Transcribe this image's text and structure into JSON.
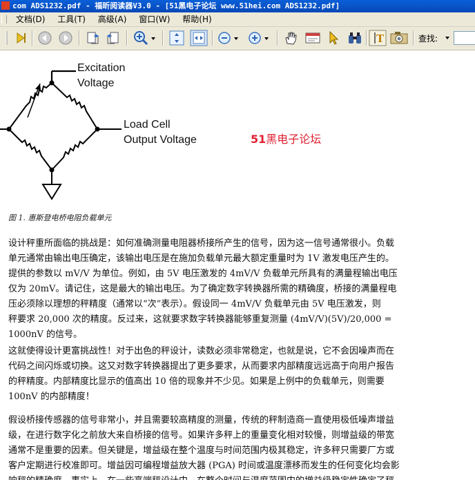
{
  "window": {
    "title": "com ADS1232.pdf - 福昕阅读器V3.0 - [51黑电子论坛 www.51hei.com ADS1232.pdf]"
  },
  "menu": {
    "items": [
      "文档(D)",
      "工具(T)",
      "高级(A)",
      "窗口(W)",
      "帮助(H)"
    ]
  },
  "toolbar": {
    "find_label": "查找:",
    "find_value": ""
  },
  "figure": {
    "label_excitation_1": "Excitation",
    "label_excitation_2": "Voltage",
    "label_output_1": "Load Cell",
    "label_output_2": "Output Voltage",
    "watermark_num": "51",
    "watermark_text": "黑电子论坛",
    "caption": "图 1. 惠斯登电桥电阻负载单元"
  },
  "paragraphs": [
    {
      "lines": [
        "设计秤重所面临的挑战是：如何准确测量电阻器桥接所产生的信号，因为这一信号通常很小。负载",
        "单元通常由输出电压确定，该输出电压是在施加负载单元最大额定重量时为 1V 激发电压产生的。",
        "提供的参数以 mV/V 为单位。例如，由 5V 电压激发的 4mV/V 负载单元所具有的满量程输出电压",
        "仅为 20mV。请记住，这是最大的输出电压。为了确定数字转换器所需的精确度，桥接的满量程电",
        "压必须除以理想的秤精度（通常以“次”表示）。假设同一 4mV/V 负载单元由 5V 电压激发，则",
        "秤要求 20,000 次的精度。反过来，这就要求数字转换器能够重复测量 (4mV/V)(5V)/20,000 =",
        "1000nV 的信号。"
      ]
    },
    {
      "lines": [
        "这就使得设计更富挑战性！对于出色的秤设计，读数必须非常稳定，也就是说，它不会因噪声而在",
        "代码之间闪烁或切换。这又对数字转换器提出了更多要求，从而要求内部精度远远高于向用户报告",
        "的秤精度。内部精度比显示的值高出 10 倍的现象并不少见。如果是上例中的负载单元，则需要",
        "100nV 的内部精度！"
      ]
    },
    {
      "lines": [
        "假设桥接传感器的信号非常小，并且需要较高精度的测量，传统的秤制造商一直使用极低噪声增益",
        "级，在进行数字化之前放大来自桥接的信号。如果许多秤上的重量变化相对较慢，则增益级的带宽",
        "通常不是重要的因素。但关键是，增益级在整个温度与时间范围内极其稳定，许多秤只需要厂方或",
        "客户定期进行校准即可。增益因可编程增益放大器 (PGA) 时间或温度漂移而发生的任何变化均会影",
        "响秤的精确度。事实上，在一些高端秤设计中，在整个时间与温度范围内的增益级稳定性确定了秤"
      ]
    }
  ]
}
